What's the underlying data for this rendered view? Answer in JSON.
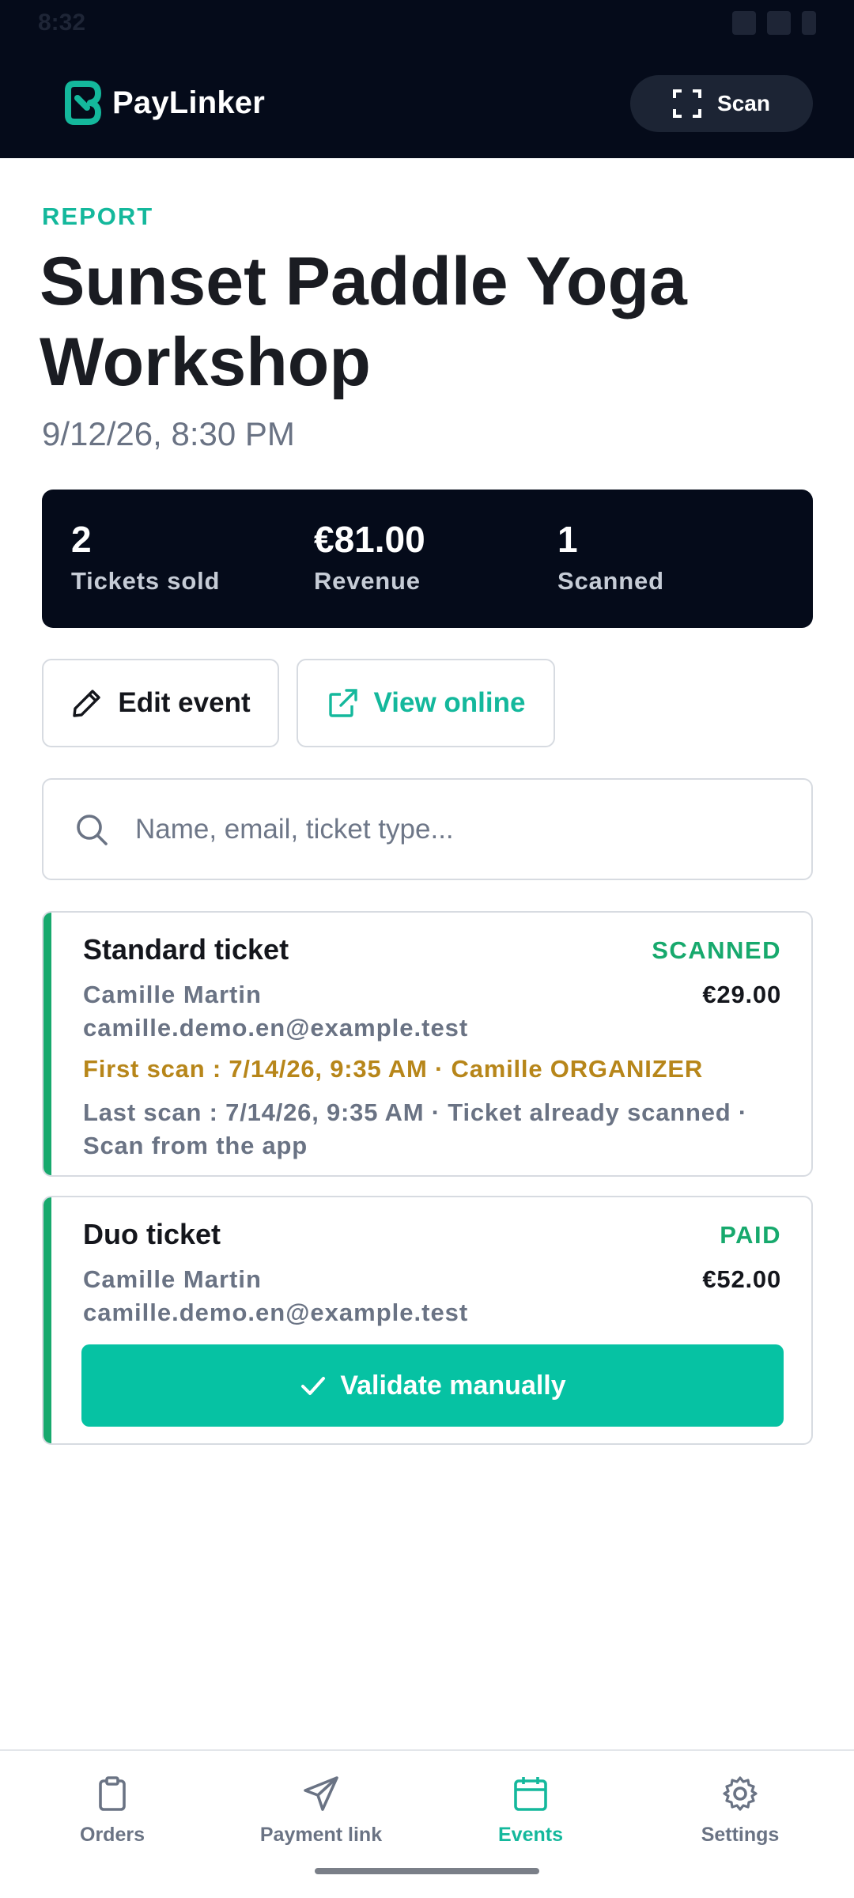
{
  "status_bar": {
    "time": "8:32"
  },
  "app": {
    "name": "PayLinker",
    "scan_label": "Scan",
    "brand_color": "#14b89c"
  },
  "event": {
    "kicker": "REPORT",
    "title": "Sunset Paddle Yoga Workshop",
    "date": "9/12/26, 8:30 PM"
  },
  "stats": [
    {
      "value": "2",
      "label": "Tickets sold"
    },
    {
      "value": "€81.00",
      "label": "Revenue"
    },
    {
      "value": "1",
      "label": "Scanned"
    }
  ],
  "actions": {
    "edit_label": "Edit event",
    "view_label": "View online"
  },
  "search": {
    "placeholder": "Name, email, ticket type...",
    "value": ""
  },
  "tickets": [
    {
      "type": "Standard ticket",
      "status": "SCANNED",
      "holder": "Camille Martin",
      "price": "€29.00",
      "email": "camille.demo.en@example.test",
      "first_scan": "First scan : 7/14/26, 9:35 AM · Camille ORGANIZER",
      "last_scan": "Last scan : 7/14/26, 9:35 AM · Ticket already scanned · Scan from the app"
    },
    {
      "type": "Duo ticket",
      "status": "PAID",
      "holder": "Camille Martin",
      "price": "€52.00",
      "email": "camille.demo.en@example.test",
      "validate_label": "Validate manually"
    }
  ],
  "nav": [
    {
      "label": "Orders",
      "icon": "clipboard-icon",
      "active": false
    },
    {
      "label": "Payment link",
      "icon": "send-icon",
      "active": false
    },
    {
      "label": "Events",
      "icon": "calendar-icon",
      "active": true
    },
    {
      "label": "Settings",
      "icon": "gear-icon",
      "active": false
    }
  ]
}
